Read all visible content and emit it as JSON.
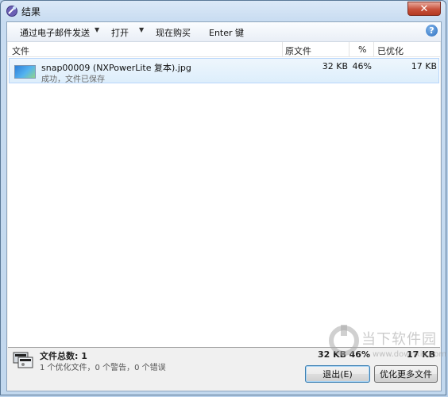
{
  "window": {
    "title": "结果",
    "close_glyph": "✕"
  },
  "toolbar": {
    "email_label": "通过电子邮件发送",
    "open_label": "打开",
    "buy_label": "现在购买",
    "enter_key_label": "Enter 键",
    "dropdown_glyph": "▼",
    "help_glyph": "?"
  },
  "columns": {
    "file": "文件",
    "original": "原文件",
    "percent": "%",
    "optimized": "已优化"
  },
  "files": [
    {
      "name": "snap00009 (NXPowerLite 复本).jpg",
      "status": "成功，文件已保存",
      "original": "32 KB",
      "percent": "46%",
      "optimized": "17 KB"
    }
  ],
  "summary": {
    "title": "文件总数: 1",
    "detail": "1 个优化文件，0 个警告，0 个错误",
    "original": "32 KB",
    "percent": "46%",
    "optimized": "17 KB"
  },
  "buttons": {
    "exit": "退出(E)",
    "optimize_more": "优化更多文件"
  },
  "watermark": {
    "text": "当下软件园",
    "url": "www.downxia.com"
  },
  "colors": {
    "selection": "#ddeefb",
    "selection_border": "#b8d6fb",
    "titlebar": "#c8dcf1",
    "close": "#c7503a"
  },
  "icons": {
    "app": "nxpowerlite-icon",
    "file": "image-thumbnail-icon",
    "summary": "files-summary-icon",
    "help": "help-icon"
  }
}
